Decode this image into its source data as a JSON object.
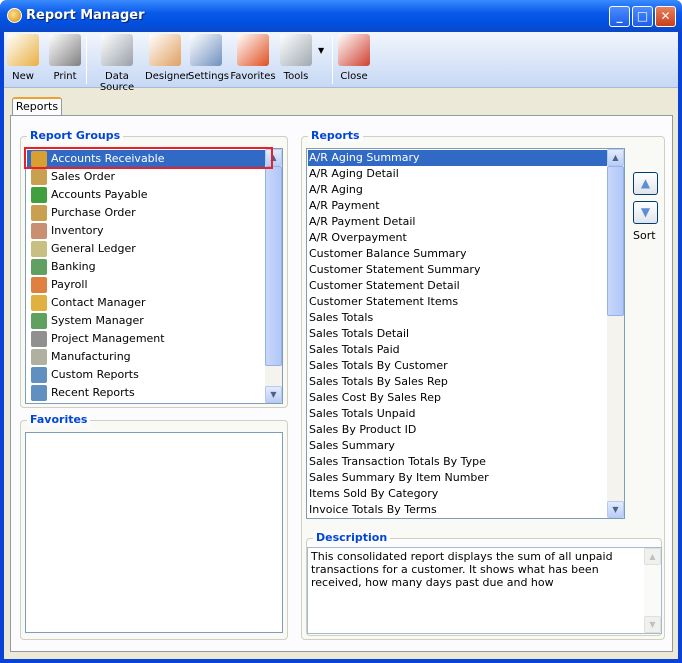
{
  "window": {
    "title": "Report Manager"
  },
  "toolbar": [
    {
      "label": "New",
      "icon": "new-report-icon",
      "color": "#e8b040"
    },
    {
      "label": "Print",
      "icon": "printer-icon",
      "color": "#808080"
    },
    {
      "label": "Data Source",
      "icon": "database-icon",
      "color": "#9aa0a8"
    },
    {
      "label": "Designer",
      "icon": "designer-icon",
      "color": "#e0a060"
    },
    {
      "label": "Settings",
      "icon": "settings-icon",
      "color": "#7090c0"
    },
    {
      "label": "Favorites",
      "icon": "favorites-heart-icon",
      "color": "#e05020"
    },
    {
      "label": "Tools",
      "icon": "tools-icon",
      "color": "#a0a8b0"
    },
    {
      "label": "Close",
      "icon": "close-report-icon",
      "color": "#d04030"
    }
  ],
  "tabs": [
    {
      "label": "Reports"
    }
  ],
  "report_groups": {
    "legend": "Report Groups",
    "selected": 0,
    "items": [
      {
        "label": "Accounts Receivable",
        "color": "#d8a030"
      },
      {
        "label": "Sales Order",
        "color": "#c8a050"
      },
      {
        "label": "Accounts Payable",
        "color": "#40a040"
      },
      {
        "label": "Purchase Order",
        "color": "#c8a050"
      },
      {
        "label": "Inventory",
        "color": "#c89070"
      },
      {
        "label": "General Ledger",
        "color": "#c8c080"
      },
      {
        "label": "Banking",
        "color": "#60a060"
      },
      {
        "label": "Payroll",
        "color": "#e08040"
      },
      {
        "label": "Contact Manager",
        "color": "#e0b040"
      },
      {
        "label": "System Manager",
        "color": "#60a060"
      },
      {
        "label": "Project Management",
        "color": "#909090"
      },
      {
        "label": "Manufacturing",
        "color": "#b0b0a0"
      },
      {
        "label": "Custom Reports",
        "color": "#6090c0"
      },
      {
        "label": "Recent Reports",
        "color": "#6090c0"
      }
    ]
  },
  "favorites": {
    "legend": "Favorites",
    "items": []
  },
  "reports": {
    "legend": "Reports",
    "selected": 0,
    "items": [
      "A/R Aging Summary",
      "A/R Aging Detail",
      "A/R Aging",
      "A/R Payment",
      "A/R Payment Detail",
      "A/R Overpayment",
      "Customer Balance Summary",
      "Customer Statement Summary",
      "Customer Statement Detail",
      "Customer Statement Items",
      "Sales Totals",
      "Sales Totals Detail",
      "Sales Totals Paid",
      "Sales Totals By Customer",
      "Sales Totals By Sales Rep",
      "Sales Cost By Sales Rep",
      "Sales Totals Unpaid",
      "Sales By Product ID",
      "Sales Summary",
      "Sales Transaction Totals By Type",
      "Sales Summary By Item Number",
      "Items Sold By Category",
      "Invoice Totals By Terms"
    ]
  },
  "sort": {
    "label": "Sort"
  },
  "description": {
    "legend": "Description",
    "text": "This consolidated report displays the sum of all unpaid transactions for a customer.  It shows what has been received, how many days past due and how"
  }
}
